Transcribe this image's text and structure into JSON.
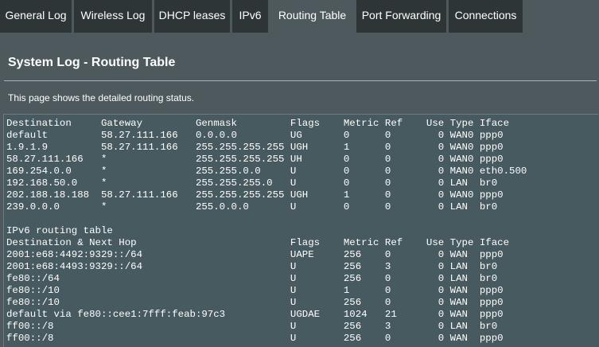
{
  "tabs": [
    {
      "label": "General Log"
    },
    {
      "label": "Wireless Log"
    },
    {
      "label": "DHCP leases"
    },
    {
      "label": "IPv6"
    },
    {
      "label": "Routing Table"
    },
    {
      "label": "Port Forwarding"
    },
    {
      "label": "Connections"
    }
  ],
  "active_tab": "Routing Table",
  "page": {
    "title": "System Log - Routing Table",
    "description": "This page shows the detailed routing status."
  },
  "routing_log": "Destination     Gateway         Genmask         Flags    Metric Ref    Use Type Iface\ndefault         58.27.111.166   0.0.0.0         UG       0      0        0 WAN0 ppp0\n1.9.1.9         58.27.111.166   255.255.255.255 UGH      1      0        0 WAN0 ppp0\n58.27.111.166   *               255.255.255.255 UH       0      0        0 WAN0 ppp0\n169.254.0.0     *               255.255.0.0     U        0      0        0 MAN0 eth0.500\n192.168.50.0    *               255.255.255.0   U        0      0        0 LAN  br0\n202.188.18.188  58.27.111.166   255.255.255.255 UGH      1      0        0 WAN0 ppp0\n239.0.0.0       *               255.0.0.0       U        0      0        0 LAN  br0\n\nIPv6 routing table\nDestination & Next Hop                          Flags    Metric Ref    Use Type Iface\n2001:e68:4492:9329::/64                         UAPE     256    0        0 WAN  ppp0\n2001:e68:4493:9329::/64                         U        256    3        0 LAN  br0\nfe80::/64                                       U        256    0        0 LAN  br0\nfe80::/10                                       U        1      0        0 WAN  ppp0\nfe80::/10                                       U        256    0        0 WAN  ppp0\ndefault via fe80::cee1:7fff:feab:97c3           UGDAE    1024   21       0 WAN  ppp0\nff00::/8                                        U        256    3        0 LAN  br0\nff00::/8                                        U        256    0        0 WAN  ppp0"
}
